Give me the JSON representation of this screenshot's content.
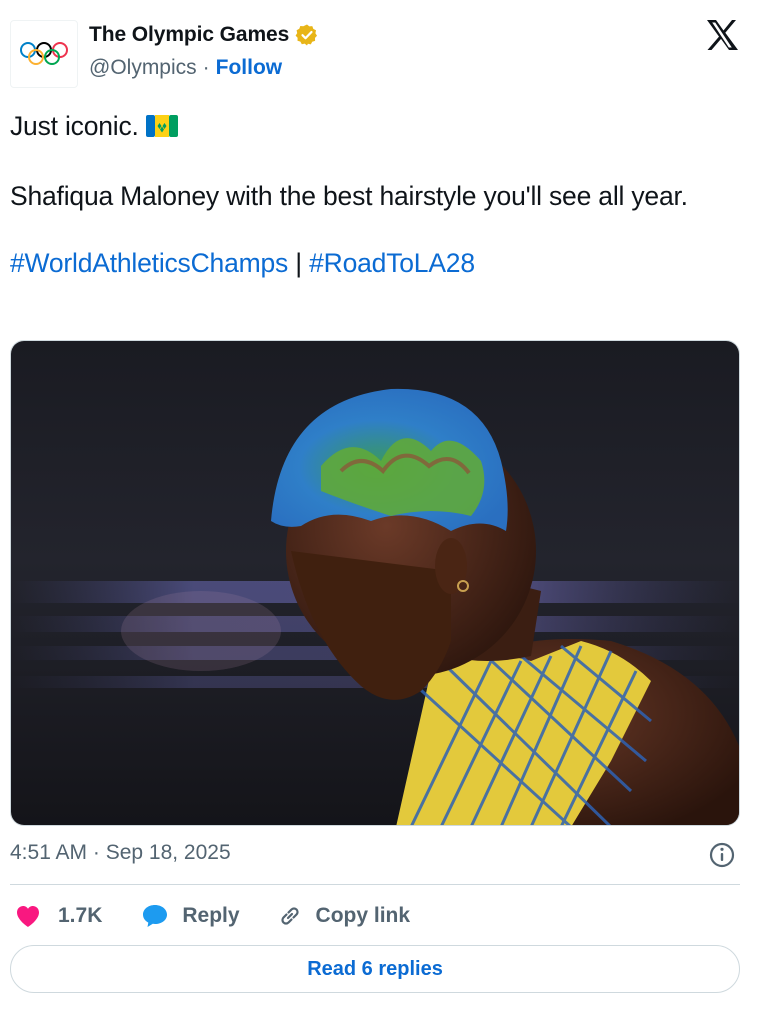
{
  "author": {
    "display_name": "The Olympic Games",
    "handle": "@Olympics",
    "separator": "·",
    "follow_label": "Follow",
    "verified_badge_color": "#e8b518",
    "avatar_icon": "olympic-rings-icon"
  },
  "tweet": {
    "line1": "Just iconic.",
    "line2": "Shafiqua Maloney with the best hairstyle you'll see all year.",
    "hashtag1": "#WorldAthleticsChamps",
    "hashtag_separator": " | ",
    "hashtag2": "#RoadToLA28",
    "flag_icon": "saint-vincent-and-the-grenadines-flag-icon"
  },
  "meta": {
    "timestamp": "4:51 AM · Sep 18, 2025"
  },
  "actions": {
    "like_count": "1.7K",
    "reply_label": "Reply",
    "copy_label": "Copy link"
  },
  "read_replies_label": "Read 6 replies",
  "colors": {
    "link_blue": "#0b6bd3",
    "secondary_text": "#536471",
    "heart_pink": "#f91880",
    "reply_blue": "#1d9bf0",
    "border": "#cfd9de"
  }
}
